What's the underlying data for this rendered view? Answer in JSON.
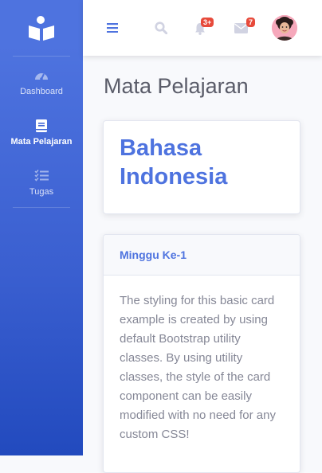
{
  "sidebar": {
    "brand_icon": "open-book-icon",
    "items": [
      {
        "label": "Dashboard",
        "icon": "tachometer-icon",
        "active": false
      },
      {
        "label": "Mata Pelajaran",
        "icon": "book-icon",
        "active": true
      },
      {
        "label": "Tugas",
        "icon": "tasks-icon",
        "active": false
      }
    ]
  },
  "topbar": {
    "menu_icon": "hamburger-icon",
    "search_icon": "search-icon",
    "alerts_badge": "3+",
    "messages_badge": "7",
    "avatar_icon": "user-avatar"
  },
  "page": {
    "title": "Mata Pelajaran"
  },
  "subject_card": {
    "name": "Bahasa Indonesia"
  },
  "week_card": {
    "header": "Minggu Ke-1",
    "body": "The styling for this basic card example is created by using default Bootstrap utility classes. By using utility classes, the style of the card component can be easily modified with no need for any custom CSS!"
  },
  "colors": {
    "primary": "#4e73df",
    "danger": "#e74a3b",
    "text_muted": "#858796",
    "title_text": "#5a5c69"
  }
}
